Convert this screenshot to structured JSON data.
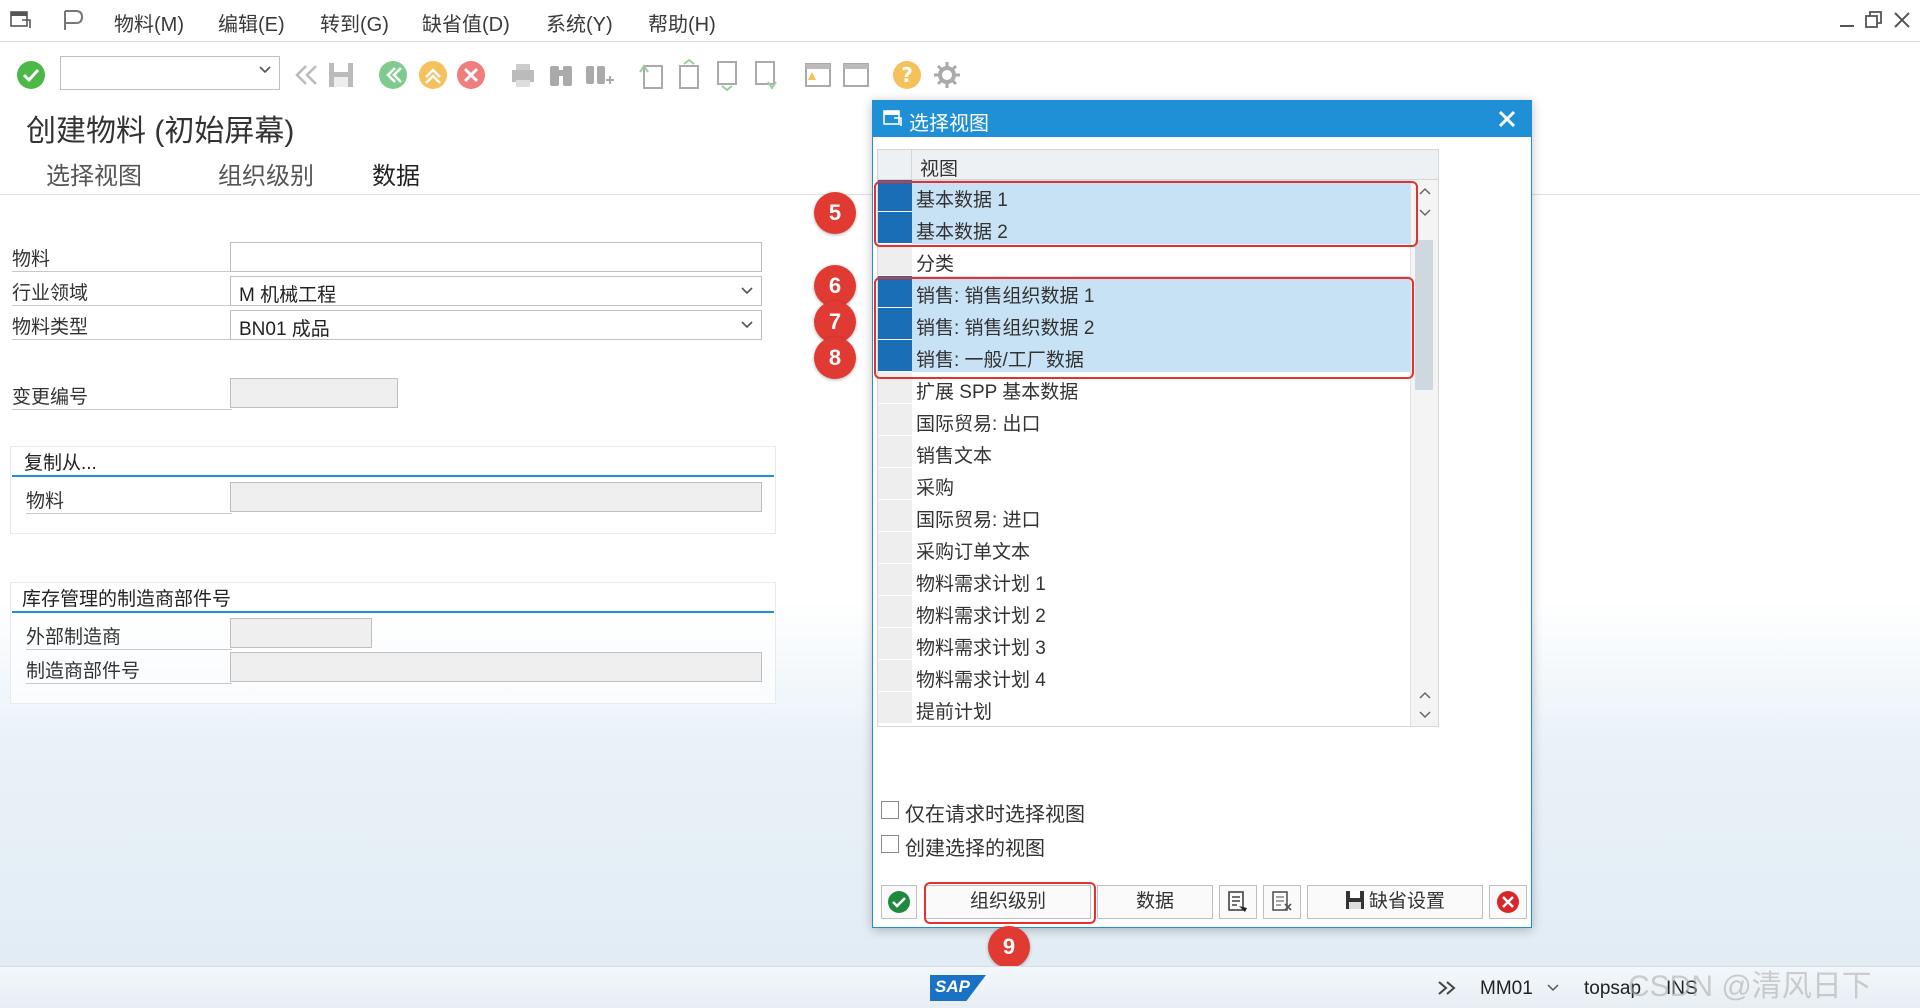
{
  "menubar": {
    "items": [
      {
        "label": "物料(M)"
      },
      {
        "label": "编辑(E)"
      },
      {
        "label": "转到(G)"
      },
      {
        "label": "缺省值(D)"
      },
      {
        "label": "系统(Y)"
      },
      {
        "label": "帮助(H)"
      }
    ]
  },
  "page": {
    "title": "创建物料 (初始屏幕)",
    "tabs": [
      "选择视图",
      "组织级别",
      "数据"
    ]
  },
  "form": {
    "material_label": "物料",
    "material_value": "",
    "industry_label": "行业领域",
    "industry_value": "M 机械工程",
    "type_label": "物料类型",
    "type_value": "BN01 成品",
    "change_no_label": "变更编号",
    "copy_group_title": "复制从...",
    "copy_material_label": "物料",
    "mpn_group_title": "库存管理的制造商部件号",
    "ext_mfr_label": "外部制造商",
    "mfr_part_label": "制造商部件号"
  },
  "dialog": {
    "title": "选择视图",
    "column_header": "视图",
    "rows": [
      {
        "label": "基本数据 1",
        "selected": true
      },
      {
        "label": "基本数据 2",
        "selected": true
      },
      {
        "label": "分类",
        "selected": false
      },
      {
        "label": "销售: 销售组织数据 1",
        "selected": true
      },
      {
        "label": "销售: 销售组织数据 2",
        "selected": true
      },
      {
        "label": "销售: 一般/工厂数据",
        "selected": true
      },
      {
        "label": "扩展 SPP 基本数据",
        "selected": false
      },
      {
        "label": "国际贸易: 出口",
        "selected": false
      },
      {
        "label": "销售文本",
        "selected": false
      },
      {
        "label": "采购",
        "selected": false
      },
      {
        "label": "国际贸易: 进口",
        "selected": false
      },
      {
        "label": "采购订单文本",
        "selected": false
      },
      {
        "label": "物料需求计划 1",
        "selected": false
      },
      {
        "label": "物料需求计划 2",
        "selected": false
      },
      {
        "label": "物料需求计划 3",
        "selected": false
      },
      {
        "label": "物料需求计划 4",
        "selected": false
      },
      {
        "label": "提前计划",
        "selected": false
      }
    ],
    "checkbox_only_on_request": "仅在请求时选择视图",
    "checkbox_create_selected": "创建选择的视图",
    "btn_org_levels": "组织级别",
    "btn_data": "数据",
    "btn_default_settings": "缺省设置"
  },
  "annotations": [
    "5",
    "6",
    "7",
    "8",
    "9"
  ],
  "statusbar": {
    "logo": "SAP",
    "tcode": "MM01",
    "server": "topsap",
    "mode": "INS",
    "watermark": "CSDN @清风日下"
  },
  "colors": {
    "accent": "#1f8fd6",
    "selected_row": "#c8e2f5",
    "annotation_red": "#e53030"
  }
}
